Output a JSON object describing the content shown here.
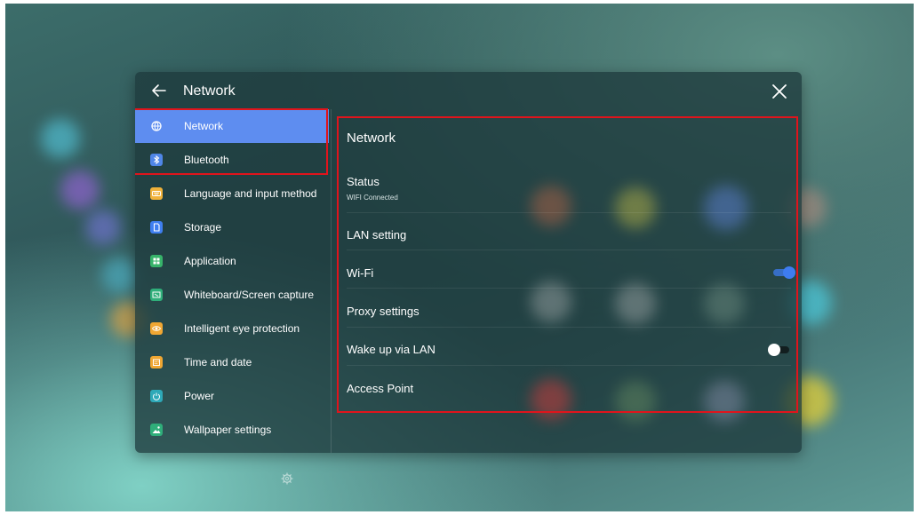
{
  "header": {
    "title": "Network",
    "back_icon": "arrow-left-icon",
    "close_icon": "close-icon"
  },
  "sidebar": {
    "items": [
      {
        "label": "Network",
        "icon": "globe-icon",
        "icon_color": "#5e8df0",
        "active": true
      },
      {
        "label": "Bluetooth",
        "icon": "bluetooth-icon",
        "icon_color": "#4f86e8",
        "active": false
      },
      {
        "label": "Language and input method",
        "icon": "keyboard-icon",
        "icon_color": "#f0b23a",
        "active": false
      },
      {
        "label": "Storage",
        "icon": "storage-icon",
        "icon_color": "#3f7ff0",
        "active": false
      },
      {
        "label": "Application",
        "icon": "apps-icon",
        "icon_color": "#37b36a",
        "active": false
      },
      {
        "label": "Whiteboard/Screen capture",
        "icon": "screen-capture-icon",
        "icon_color": "#2fae7a",
        "active": false
      },
      {
        "label": "Intelligent eye protection",
        "icon": "eye-icon",
        "icon_color": "#f0a733",
        "active": false
      },
      {
        "label": "Time and date",
        "icon": "calendar-icon",
        "icon_color": "#f0a733",
        "active": false
      },
      {
        "label": "Power",
        "icon": "power-icon",
        "icon_color": "#2ea9b8",
        "active": false
      },
      {
        "label": "Wallpaper settings",
        "icon": "image-icon",
        "icon_color": "#2fae7a",
        "active": false
      }
    ]
  },
  "content": {
    "title": "Network",
    "status": {
      "label": "Status",
      "value": "WIFI Connected"
    },
    "lan_setting": {
      "label": "LAN setting"
    },
    "wifi": {
      "label": "Wi-Fi",
      "enabled": true
    },
    "proxy": {
      "label": "Proxy settings"
    },
    "wake_lan": {
      "label": "Wake up via LAN",
      "enabled": false
    },
    "access_point": {
      "label": "Access Point"
    }
  },
  "colors": {
    "accent": "#5e8df0",
    "toggle_on": "#3e7cf0",
    "toggle_off_knob": "#ffffff",
    "highlight": "#e0141c"
  },
  "footer": {
    "icon": "gear-icon"
  }
}
